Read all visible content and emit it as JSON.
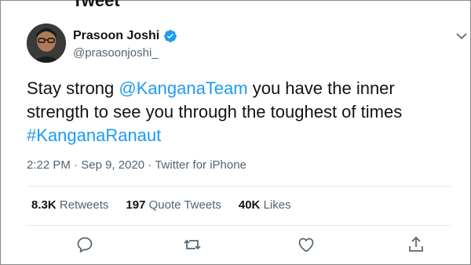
{
  "header": {
    "title_fragment": "Tweet"
  },
  "author": {
    "name": "Prasoon Joshi",
    "handle": "@prasoonjoshi_",
    "verified": true
  },
  "tweet": {
    "text_part1": "Stay strong ",
    "mention": "@KanganaTeam",
    "text_part2": " you have the inner strength to see you through the toughest  of times",
    "hashtag": "#KanganaRanaut"
  },
  "meta": {
    "time": "2:22 PM",
    "separator1": "·",
    "date": "Sep 9, 2020",
    "separator2": "·",
    "source": "Twitter for iPhone"
  },
  "stats": {
    "retweets_count": "8.3K",
    "retweets_label": "Retweets",
    "quotes_count": "197",
    "quotes_label": "Quote Tweets",
    "likes_count": "40K",
    "likes_label": "Likes"
  },
  "colors": {
    "link": "#1d9bf0",
    "text": "#0f1419",
    "muted": "#536471",
    "divider": "#e4e8eb"
  },
  "icons": [
    "verified-badge-icon",
    "more-chevron-icon",
    "reply-icon",
    "retweet-icon",
    "like-icon",
    "share-icon"
  ]
}
